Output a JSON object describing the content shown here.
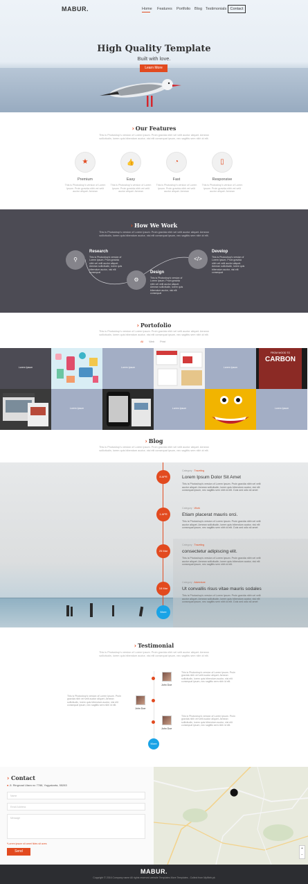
{
  "brand": {
    "logo": "MABUR."
  },
  "nav": {
    "items": [
      "Home",
      "Features",
      "Portfolio",
      "Blog",
      "Testimonials"
    ],
    "contact_label": "Contact"
  },
  "hero": {
    "title": "High Quality Template",
    "subtitle": "Built with love.",
    "button": "Learn More"
  },
  "features": {
    "title": "Our Features",
    "desc": "This is Photoshop's version of Lorem Ipsum. Proin gravida nibh vel velit auctor aliquet. Aenean sollicitudin, lorem quis bibendum auctor, nisi elit consequat ipsum, nec sagittis sem nibh id elit.",
    "items": [
      {
        "name": "Premium",
        "icon": "star-icon",
        "text": "This is Photoshop's version of Lorem Ipsum. Proin gravida nibh vel velit auctor aliquet. Aenean"
      },
      {
        "name": "Easy",
        "icon": "thumbs-up-icon",
        "text": "This is Photoshop's version of Lorem Ipsum. Proin gravida nibh vel velit auctor aliquet. Aenean"
      },
      {
        "name": "Fast",
        "icon": "speedometer-icon",
        "text": "This is Photoshop's version of Lorem Ipsum. Proin gravida nibh vel velit auctor aliquet. Aenean"
      },
      {
        "name": "Responsive",
        "icon": "mobile-icon",
        "text": "This is Photoshop's version of Lorem Ipsum. Proin gravida nibh vel velit auctor aliquet. Aenean"
      }
    ]
  },
  "work": {
    "title": "How We Work",
    "desc": "This is Photoshop's version of Lorem Ipsum. Proin gravida nibh vel velit auctor aliquet. Aenean sollicitudin, lorem quis bibendum auctor, nisi elit consequat ipsum, nec sagittis sem nibh id elit.",
    "steps": [
      {
        "name": "Research",
        "icon": "search-icon",
        "text": "This is Photoshop's version of Lorem Ipsum. Proin gravida nibh vel velit auctor aliquet. Aenean sollicitudin, lorem quis bibendum auctor, nisi elit consequat"
      },
      {
        "name": "Design",
        "icon": "gears-icon",
        "text": "This is Photoshop's version of Lorem Ipsum. Proin gravida nibh vel velit auctor aliquet. Aenean sollicitudin, lorem quis bibendum auctor, nisi elit consequat"
      },
      {
        "name": "Develop",
        "icon": "code-icon",
        "text": "This is Photoshop's version of Lorem Ipsum. Proin gravida nibh vel velit auctor aliquet. Aenean sollicitudin, lorem quis bibendum auctor, nisi elit consequat"
      }
    ]
  },
  "portfolio": {
    "title": "Portofolio",
    "desc": "This is Photoshop's version of Lorem Ipsum. Proin gravida nibh vel velit auctor aliquet. Aenean sollicitudin, lorem quis bibendum auctor, nisi elit consequat ipsum, nec sagittis sem nibh id elit.",
    "filters": [
      "All",
      "Web",
      "Print"
    ],
    "tile_label": "Lorem Ipsum",
    "carbon_text": "CARBON",
    "carbon_top": "FROM WOOD TO"
  },
  "blog": {
    "title": "Blog",
    "desc": "This is Photoshop's version of Lorem Ipsum. Proin gravida nibh vel velit auctor aliquet. Aenean sollicitudin, lorem quis bibendum auctor, nisi elit consequat ipsum, nec sagittis sem nibh id elit.",
    "category_label": "Category :",
    "posts": [
      {
        "date": "8 APR",
        "category": "Traveling",
        "title": "Lorem Ipsum Dolor Sit Amet",
        "text": "This is Photoshop's version of Lorem Ipsum. Proin gravida nibh vel velit auctor aliquet. Aenean sollicitudin, lorem quis bibendum auctor, nisi elit consequat ipsum, nec sagittis sem nibh id elit. Duis sed odio sit amet"
      },
      {
        "date": "1 APR",
        "category": "Work",
        "title": "Etiam placerat mauris orci.",
        "text": "This is Photoshop's version of Lorem Ipsum. Proin gravida nibh vel velit auctor aliquet. Aenean sollicitudin, lorem quis bibendum auctor, nisi elit consequat ipsum, nec sagittis sem nibh id elit. Duis sed odio sit amet"
      },
      {
        "date": "25 Mar",
        "category": "Traveling",
        "title": "consectetur adipiscing elit.",
        "text": "This is Photoshop's version of Lorem Ipsum. Proin gravida nibh vel velit auctor aliquet. Aenean sollicitudin, lorem quis bibendum auctor, nisi elit consequat ipsum, nec sagittis sem nibh id elit."
      },
      {
        "date": "18 Mar",
        "category": "Adventure",
        "title": "Ut convallis risus vitae mauris sodales",
        "text": "This is Photoshop's version of Lorem Ipsum. Proin gravida nibh vel velit auctor aliquet. Aenean sollicitudin, lorem quis bibendum auctor, nisi elit consequat ipsum, nec sagittis sem nibh id elit. Duis sed odio sit amet"
      }
    ],
    "more_label": "More"
  },
  "testimonial": {
    "title": "Testimonial",
    "desc": "This is Photoshop's version of Lorem Ipsum. Proin gravida nibh vel velit auctor aliquet. Aenean sollicitudin, lorem quis bibendum auctor, nisi elit consequat ipsum, nec sagittis sem nibh id elit.",
    "items": [
      {
        "name": "John Doe",
        "text": "This is Photoshop's version of Lorem Ipsum. Proin gravida nibh vel velit auctor aliquet. Aenean sollicitudin, lorem quis bibendum auctor, nisi elit consequat ipsum, nec sagittis sem nibh id elit."
      },
      {
        "name": "John Doe",
        "text": "This is Photoshop's version of Lorem Ipsum. Proin gravida nibh vel velit auctor aliquet. Aenean sollicitudin, lorem quis bibendum auctor, nisi elit consequat ipsum, nec sagittis sem nibh id elit."
      },
      {
        "name": "John Doe",
        "text": "This is Photoshop's version of Lorem Ipsum. Proin gravida nibh vel velit auctor aliquet. Aenean sollicitudin, lorem quis bibendum auctor, nisi elit consequat ipsum, nec sagittis sem nibh id elit."
      }
    ],
    "more_label": "More"
  },
  "contact": {
    "title": "Contact",
    "address": "Jl. Ringroad Utara no 7788, Yogyakarta, 55283",
    "name_placeholder": "Name",
    "email_placeholder": "Email Address",
    "message_placeholder": "Message",
    "note": "*Lorem ipsum sit amet fides sit aves",
    "send_label": "Send"
  },
  "footer": {
    "logo": "MABUR.",
    "copyright": "Copyright © 2016 Company name All rights reserved website Templates More Templates - Collect from MyWeb.pk"
  },
  "colors": {
    "accent": "#e24a1f",
    "dark_band": "#4c4b54",
    "tile_blue": "#a3aec5",
    "footer": "#2c2d31",
    "blue_dot": "#1aa3e6"
  }
}
